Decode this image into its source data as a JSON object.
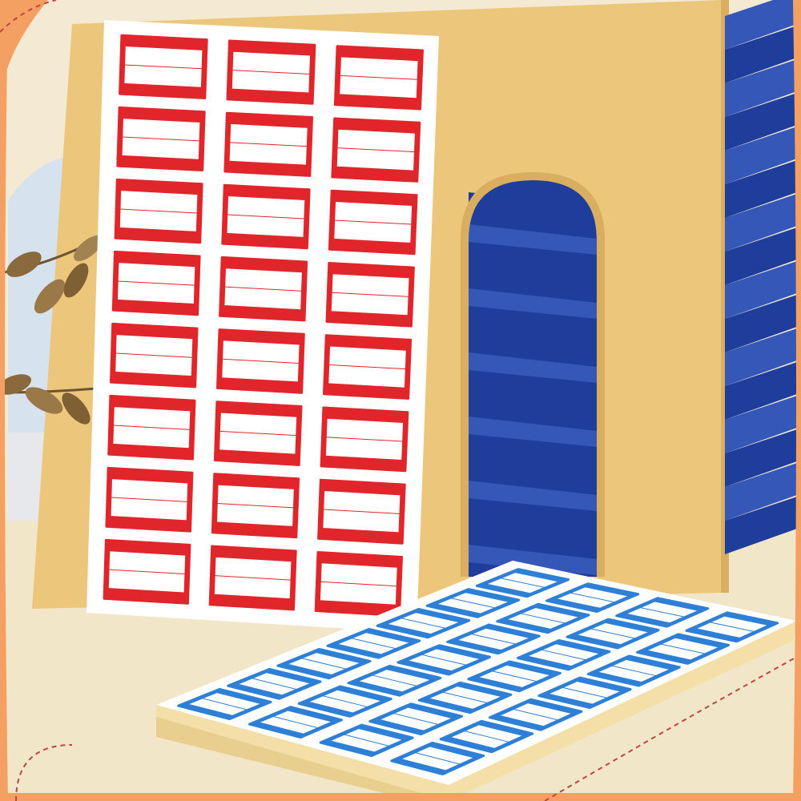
{
  "scene": {
    "description": "",
    "colors": {
      "frame": "#f3a062",
      "frame_inner": "#fbe6cf",
      "table": "#f2e6c9",
      "arch_panel": "#ecc77b",
      "arch_shadow": "#d9ae60",
      "blue_fan": "#1f3d9a",
      "blue_fan_light": "#3558b8",
      "sky": "#d7e2ef",
      "leaf": "#8a6a3c",
      "red_sheet_border": "#e0262b",
      "blue_sheet_border": "#2e7fd6",
      "label_fill": "#ffffff",
      "stack_edge": "#f4dfa8",
      "dashed_line": "#c2453d"
    },
    "objects": [
      "red-bordered-label-sheet",
      "blue-bordered-label-stack",
      "arch-display-panel",
      "blue-paper-fan",
      "dried-leaf-branch",
      "decorative-frame"
    ],
    "red_sheet": {
      "columns": 3,
      "rows": 8
    },
    "blue_stack": {
      "columns": 4,
      "rows": 7
    }
  }
}
